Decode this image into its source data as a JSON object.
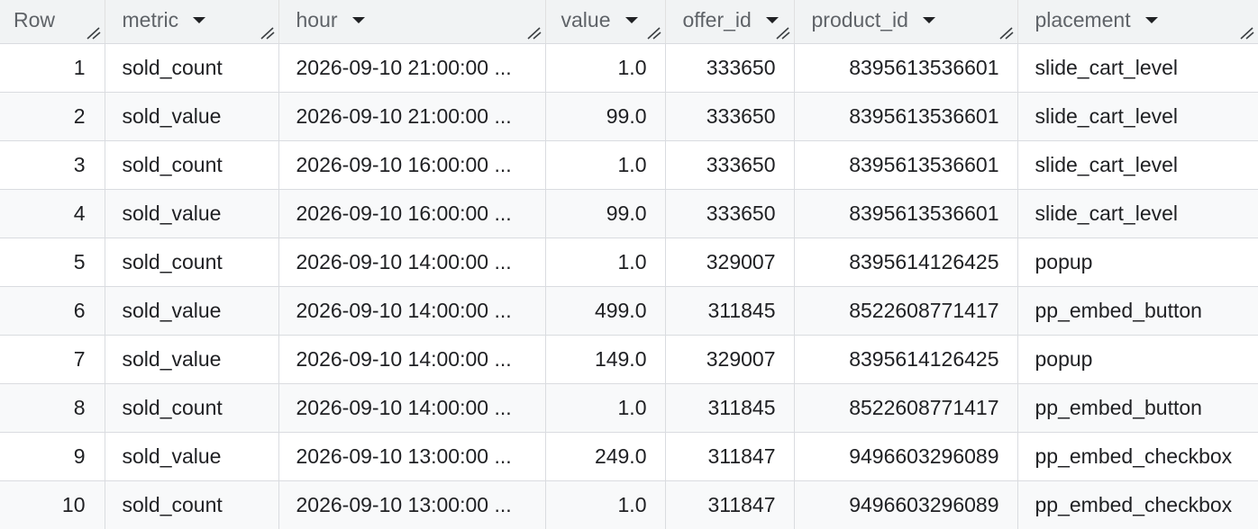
{
  "headers": {
    "row": "Row",
    "metric": "metric",
    "hour": "hour",
    "value": "value",
    "offer_id": "offer_id",
    "product_id": "product_id",
    "placement": "placement"
  },
  "icons": {
    "sort": "chevron-down-icon",
    "resize": "column-resize-icon"
  },
  "rows": [
    {
      "row": "1",
      "metric": "sold_count",
      "hour": "2026-09-10 21:00:00 ...",
      "value": "1.0",
      "offer_id": "333650",
      "product_id": "8395613536601",
      "placement": "slide_cart_level"
    },
    {
      "row": "2",
      "metric": "sold_value",
      "hour": "2026-09-10 21:00:00 ...",
      "value": "99.0",
      "offer_id": "333650",
      "product_id": "8395613536601",
      "placement": "slide_cart_level"
    },
    {
      "row": "3",
      "metric": "sold_count",
      "hour": "2026-09-10 16:00:00 ...",
      "value": "1.0",
      "offer_id": "333650",
      "product_id": "8395613536601",
      "placement": "slide_cart_level"
    },
    {
      "row": "4",
      "metric": "sold_value",
      "hour": "2026-09-10 16:00:00 ...",
      "value": "99.0",
      "offer_id": "333650",
      "product_id": "8395613536601",
      "placement": "slide_cart_level"
    },
    {
      "row": "5",
      "metric": "sold_count",
      "hour": "2026-09-10 14:00:00 ...",
      "value": "1.0",
      "offer_id": "329007",
      "product_id": "8395614126425",
      "placement": "popup"
    },
    {
      "row": "6",
      "metric": "sold_value",
      "hour": "2026-09-10 14:00:00 ...",
      "value": "499.0",
      "offer_id": "311845",
      "product_id": "8522608771417",
      "placement": "pp_embed_button"
    },
    {
      "row": "7",
      "metric": "sold_value",
      "hour": "2026-09-10 14:00:00 ...",
      "value": "149.0",
      "offer_id": "329007",
      "product_id": "8395614126425",
      "placement": "popup"
    },
    {
      "row": "8",
      "metric": "sold_count",
      "hour": "2026-09-10 14:00:00 ...",
      "value": "1.0",
      "offer_id": "311845",
      "product_id": "8522608771417",
      "placement": "pp_embed_button"
    },
    {
      "row": "9",
      "metric": "sold_value",
      "hour": "2026-09-10 13:00:00 ...",
      "value": "249.0",
      "offer_id": "311847",
      "product_id": "9496603296089",
      "placement": "pp_embed_checkbox"
    },
    {
      "row": "10",
      "metric": "sold_count",
      "hour": "2026-09-10 13:00:00 ...",
      "value": "1.0",
      "offer_id": "311847",
      "product_id": "9496603296089",
      "placement": "pp_embed_checkbox"
    }
  ]
}
